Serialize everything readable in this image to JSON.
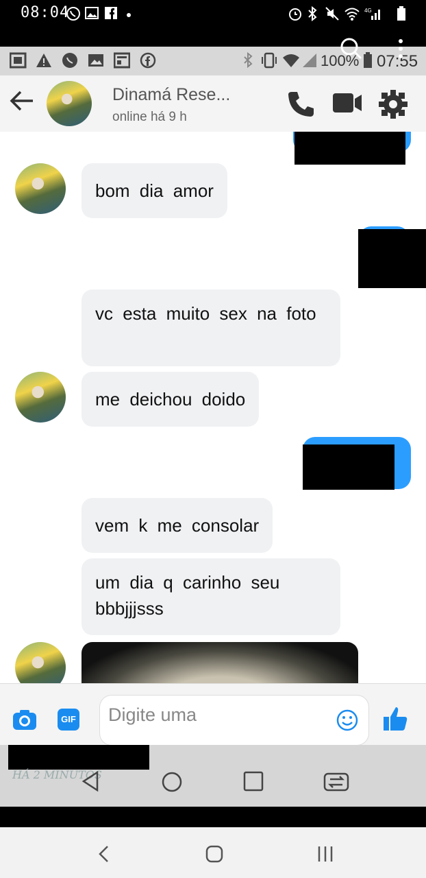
{
  "outer_status": {
    "time": "08:04"
  },
  "inner_status": {
    "battery": "100%",
    "time": "07:55"
  },
  "header": {
    "contact_name": "Dinamá Rese...",
    "contact_status": "online há 9 h"
  },
  "messages": [
    {
      "text": "bom dia amor"
    },
    {
      "text": "vc esta muito sex na foto"
    },
    {
      "text": "me deichou doido"
    },
    {
      "text": "vem k me consolar"
    },
    {
      "text": "um dia q carinho seu bbbjjjsss"
    }
  ],
  "composer": {
    "placeholder": "Digite uma",
    "gif_label": "GIF"
  },
  "watermark": "HÁ 2 MINUTOS",
  "colors": {
    "accent": "#2b9dff",
    "bubble": "#f0f1f3"
  }
}
